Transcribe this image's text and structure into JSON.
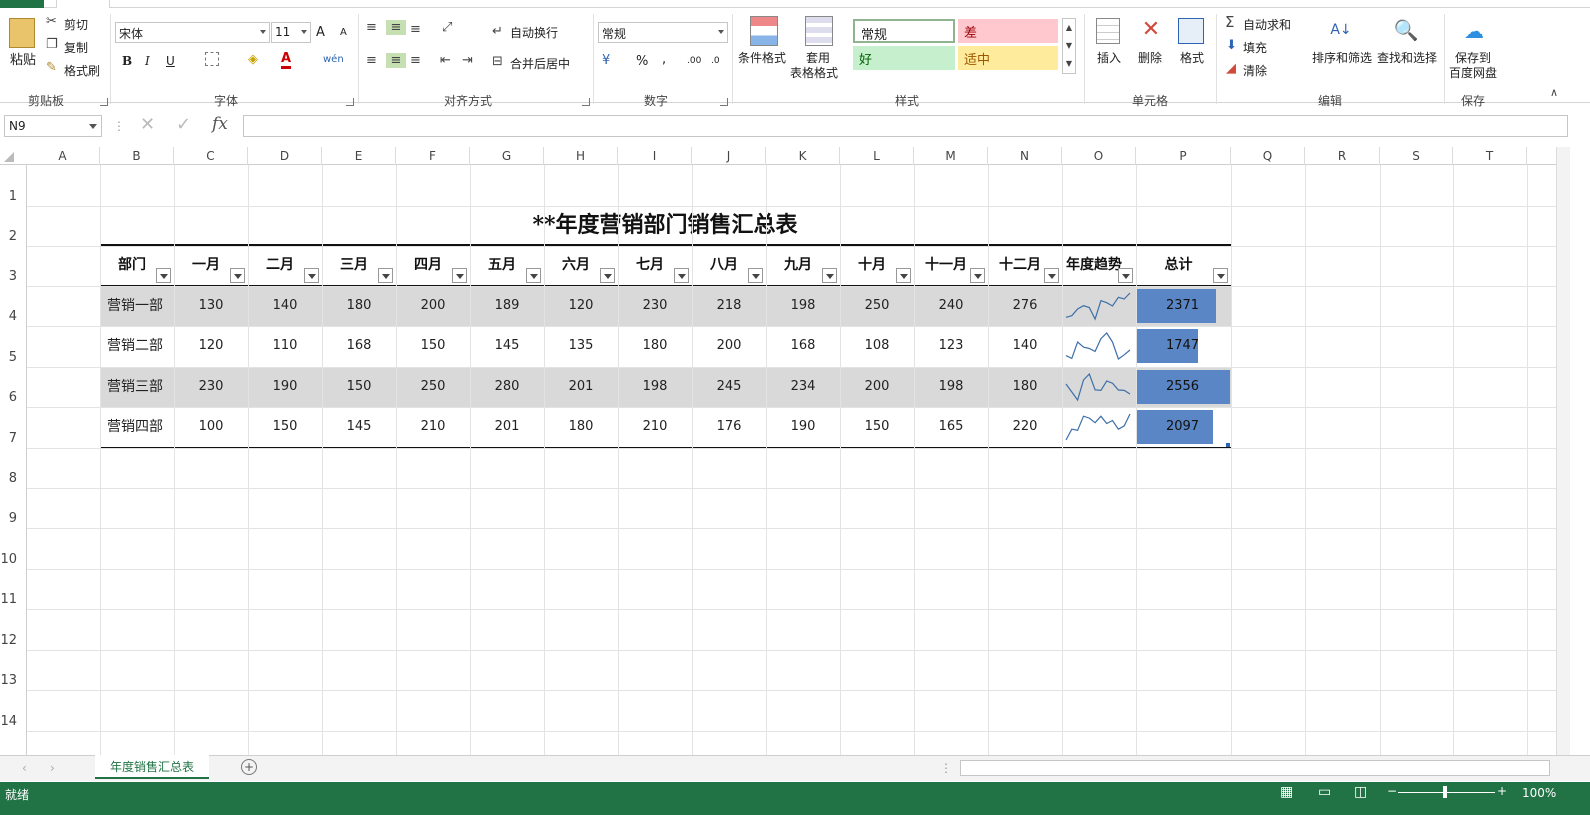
{
  "ribbon": {
    "tabs": [],
    "clipboard": {
      "paste": "粘贴",
      "cut": "剪切",
      "copy": "复制",
      "format_painter": "格式刷",
      "group": "剪贴板"
    },
    "font": {
      "name": "宋体",
      "size": "11",
      "bold": "B",
      "italic": "I",
      "underline": "U",
      "group": "字体",
      "grow": "A",
      "shrink": "A",
      "phonetic": "wén"
    },
    "alignment": {
      "wrap": "自动换行",
      "merge": "合并后居中",
      "group": "对齐方式"
    },
    "number": {
      "format": "常规",
      "percent": "%",
      "comma": ",",
      "inc": ".00",
      "dec": ".0",
      "group": "数字"
    },
    "styles": {
      "conditional": "条件格式",
      "table_format_line1": "套用",
      "table_format_line2": "表格格式",
      "normal": "常规",
      "bad": "差",
      "good": "好",
      "neutral": "适中",
      "group": "样式"
    },
    "cells": {
      "insert": "插入",
      "delete": "删除",
      "format": "格式",
      "group": "单元格"
    },
    "editing": {
      "autosum": "自动求和",
      "fill": "填充",
      "clear": "清除",
      "sort": "排序和筛选",
      "find": "查找和选择",
      "group": "编辑"
    },
    "save": {
      "line1": "保存到",
      "line2": "百度网盘",
      "group": "保存"
    }
  },
  "formula_bar": {
    "name_box": "N9",
    "fx": "fx",
    "value": ""
  },
  "columns": [
    "A",
    "B",
    "C",
    "D",
    "E",
    "F",
    "G",
    "H",
    "I",
    "J",
    "K",
    "L",
    "M",
    "N",
    "O",
    "P",
    "Q",
    "R",
    "S",
    "T"
  ],
  "rows": [
    "1",
    "2",
    "3",
    "4",
    "5",
    "6",
    "7",
    "8",
    "9",
    "10",
    "11",
    "12",
    "13",
    "14"
  ],
  "table": {
    "title": "**年度营销部门销售汇总表",
    "headers": [
      "部门",
      "一月",
      "二月",
      "三月",
      "四月",
      "五月",
      "六月",
      "七月",
      "八月",
      "九月",
      "十月",
      "十一月",
      "十二月",
      "年度趋势",
      "总计"
    ],
    "rows": [
      {
        "dept": "营销一部",
        "values": [
          130,
          140,
          180,
          200,
          189,
          120,
          230,
          218,
          198,
          250,
          240,
          276
        ],
        "total": 2371,
        "bar_fraction": 0.85
      },
      {
        "dept": "营销二部",
        "values": [
          120,
          110,
          168,
          150,
          145,
          135,
          180,
          200,
          168,
          108,
          123,
          140
        ],
        "total": 1747,
        "bar_fraction": 0.66
      },
      {
        "dept": "营销三部",
        "values": [
          230,
          190,
          150,
          250,
          280,
          201,
          198,
          245,
          234,
          200,
          198,
          180
        ],
        "total": 2556,
        "bar_fraction": 1.0
      },
      {
        "dept": "营销四部",
        "values": [
          100,
          150,
          145,
          210,
          201,
          180,
          210,
          176,
          190,
          150,
          165,
          220
        ],
        "total": 2097,
        "bar_fraction": 0.82
      }
    ]
  },
  "colors": {
    "accent": "#217346",
    "band": "#d9d9d9",
    "databar": "#5b86c5",
    "sparkline": "#3d6fa8"
  },
  "sheet_tab": "年度销售汇总表",
  "status": {
    "ready": "就绪",
    "zoom": "100%"
  }
}
